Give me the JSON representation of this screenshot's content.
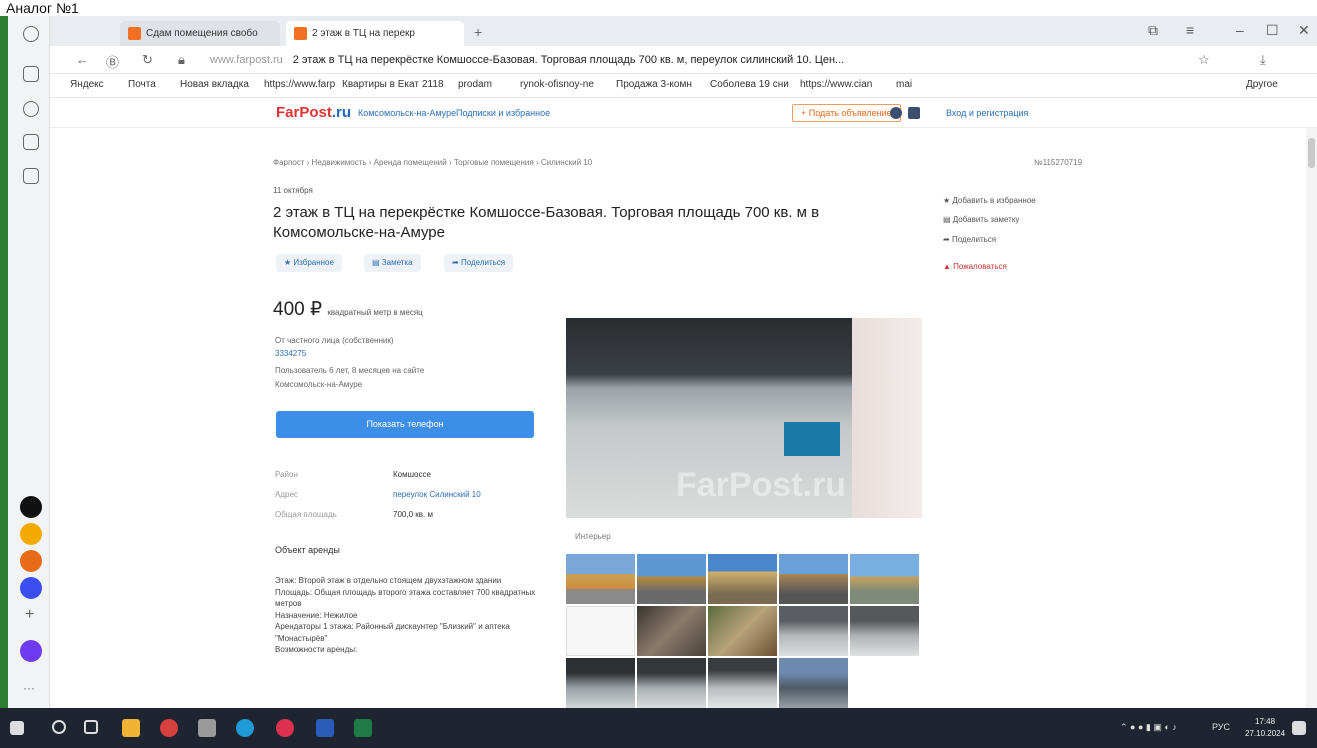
{
  "caption": "Аналог №1",
  "browser": {
    "tabs": [
      {
        "label": "Сдам помещения свобо"
      },
      {
        "label": "2 этаж в ТЦ на перекр"
      }
    ],
    "url_host": "www.farpost.ru",
    "url_title": "2 этаж в ТЦ на перекрёстке Комшоссе-Базовая. Торговая площадь 700 кв. м, переулок силинский 10. Цен...",
    "bookmarks": [
      "Яндекс",
      "Почта",
      "Новая вкладка",
      "https://www.farp",
      "Квартиры в Екат",
      "2118",
      "prodam",
      "rynok-ofisnoy-ne",
      "Продажа 3-комн",
      "Соболева 19 сни",
      "https://www.cian",
      "mai",
      "Другое"
    ]
  },
  "site": {
    "logo_a": "FarPost",
    "logo_b": ".ru",
    "city_link": "Комсомольск-на-Амуре",
    "subscriptions": "Подписки и избранное",
    "post_ad": "+ Подать объявление",
    "login": "Вход и регистрация"
  },
  "ad": {
    "breadcrumb": "Фарпост › Недвижимость › Аренда помещений › Торговые помещения › Силинский 10",
    "number": "№115270719",
    "date": "11 октября",
    "title": "2 этаж в ТЦ на перекрёстке Комшоссе-Базовая. Торговая площадь 700 кв. м в Комсомольске-на-Амуре",
    "actions": [
      "Избранное",
      "Заметка",
      "Поделиться"
    ],
    "price": "400 ₽",
    "price_unit": "квадратный метр в месяц",
    "seller_type": "От частного лица (собственник)",
    "seller_id": "3334275",
    "seller_since": "Пользователь 6 лет, 8 месяцев на сайте",
    "seller_city": "Комсомольск-на-Амуре",
    "show_phone": "Показать телефон",
    "params": [
      {
        "key": "Район",
        "value": "Комшоссе"
      },
      {
        "key": "Адрес",
        "value": "переулок Силинский 10"
      },
      {
        "key": "Общая площадь",
        "value": "700,0 кв. м"
      }
    ],
    "section_title": "Объект аренды",
    "description": [
      "Этаж: Второй этаж в отдельно стоящем двухэтажном здании",
      "Площадь: Общая площадь второго этажа составляет 700 квадратных метров",
      "Назначение: Нежилое",
      "Арендаторы 1 этажа: Районный дискаунтер \"Близкий\" и аптека \"Монастырёв\"",
      "Возможности аренды:"
    ],
    "watermark": "FarPost.ru",
    "gallery_label": "Интерьер"
  },
  "sidebar_links": [
    {
      "label": "Добавить в избранное"
    },
    {
      "label": "Добавить заметку"
    },
    {
      "label": "Поделиться"
    },
    {
      "label": "Пожаловаться"
    }
  ],
  "taskbar": {
    "lang": "РУС",
    "time": "17:48",
    "date": "27.10.2024"
  },
  "colors": {
    "accent": "#3d8ee8",
    "logo_red": "#d33333",
    "taskbar": "#1f2530"
  }
}
